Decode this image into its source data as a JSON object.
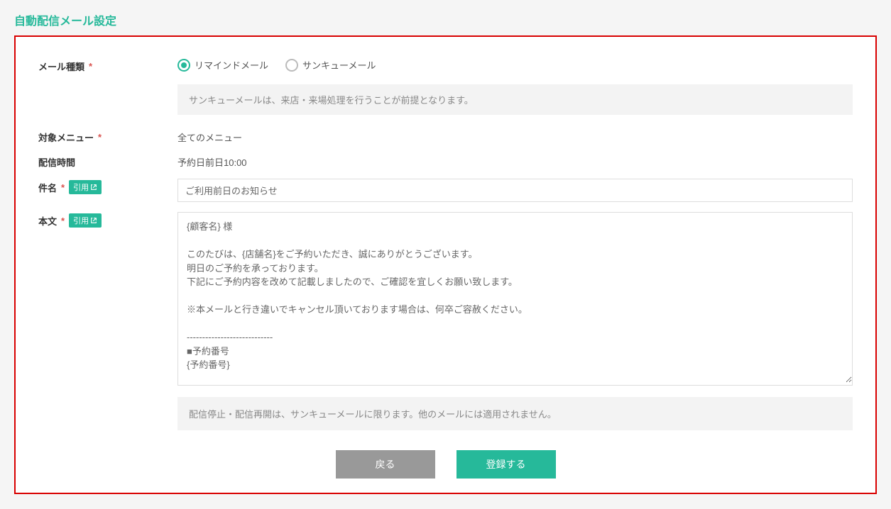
{
  "title": "自動配信メール設定",
  "labels": {
    "mail_type": "メール種類",
    "target_menu": "対象メニュー",
    "delivery_time": "配信時間",
    "subject": "件名",
    "body": "本文"
  },
  "required_mark": "*",
  "quote_badge": "引用",
  "mail_type": {
    "options": [
      {
        "label": "リマインドメール",
        "selected": true
      },
      {
        "label": "サンキューメール",
        "selected": false
      }
    ],
    "note": "サンキューメールは、来店・来場処理を行うことが前提となります。"
  },
  "target_menu_value": "全てのメニュー",
  "delivery_time_value": "予約日前日10:00",
  "subject_value": "ご利用前日のお知らせ",
  "body_value": "{顧客名} 様\n\nこのたびは、{店舗名}をご予約いただき、誠にありがとうございます。\n明日のご予約を承っております。\n下記にご予約内容を改めて記載しましたので、ご確認を宜しくお願い致します。\n\n※本メールと行き違いでキャンセル頂いております場合は、何卒ご容赦ください。\n\n----------------------------\n■予約番号\n{予約番号}\n\n■予約日時\n{予約日時}\n\n■予約人数\n{予約人数情報}",
  "bottom_note": "配信停止・配信再開は、サンキューメールに限ります。他のメールには適用されません。",
  "buttons": {
    "back": "戻る",
    "submit": "登録する"
  }
}
